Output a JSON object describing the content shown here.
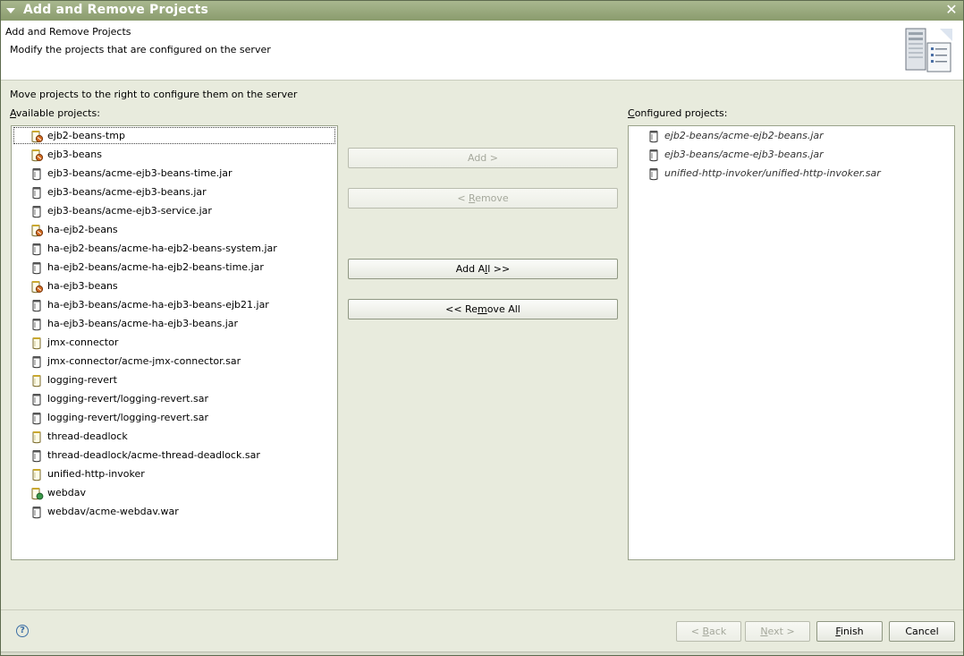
{
  "window": {
    "title": "Add and Remove Projects",
    "close_glyph": "✕"
  },
  "banner": {
    "title": "Add and Remove Projects",
    "description": "Modify the projects that are configured on the server",
    "icon": "server-icon"
  },
  "instruction": "Move projects to the right to configure them on the server",
  "available": {
    "label_mnemonic": "A",
    "label_rest": "vailable projects:",
    "items": [
      {
        "label": "ejb2-beans-tmp",
        "icon": "ejb-project-icon",
        "selected": true
      },
      {
        "label": "ejb3-beans",
        "icon": "ejb-project-icon"
      },
      {
        "label": "ejb3-beans/acme-ejb3-beans-time.jar",
        "icon": "jar-module-icon"
      },
      {
        "label": "ejb3-beans/acme-ejb3-beans.jar",
        "icon": "jar-module-icon"
      },
      {
        "label": "ejb3-beans/acme-ejb3-service.jar",
        "icon": "jar-module-icon"
      },
      {
        "label": "ha-ejb2-beans",
        "icon": "ejb-project-icon"
      },
      {
        "label": "ha-ejb2-beans/acme-ha-ejb2-beans-system.jar",
        "icon": "jar-module-icon"
      },
      {
        "label": "ha-ejb2-beans/acme-ha-ejb2-beans-time.jar",
        "icon": "jar-module-icon"
      },
      {
        "label": "ha-ejb3-beans",
        "icon": "ejb-project-icon"
      },
      {
        "label": "ha-ejb3-beans/acme-ha-ejb3-beans-ejb21.jar",
        "icon": "jar-module-icon"
      },
      {
        "label": "ha-ejb3-beans/acme-ha-ejb3-beans.jar",
        "icon": "jar-module-icon"
      },
      {
        "label": "jmx-connector",
        "icon": "sar-project-icon"
      },
      {
        "label": "jmx-connector/acme-jmx-connector.sar",
        "icon": "jar-module-icon"
      },
      {
        "label": "logging-revert",
        "icon": "sar-project-icon"
      },
      {
        "label": "logging-revert/logging-revert.sar",
        "icon": "jar-module-icon"
      },
      {
        "label": "logging-revert/logging-revert.sar",
        "icon": "jar-module-icon"
      },
      {
        "label": "thread-deadlock",
        "icon": "sar-project-icon"
      },
      {
        "label": "thread-deadlock/acme-thread-deadlock.sar",
        "icon": "jar-module-icon"
      },
      {
        "label": "unified-http-invoker",
        "icon": "sar-project-icon"
      },
      {
        "label": "webdav",
        "icon": "web-project-icon"
      },
      {
        "label": "webdav/acme-webdav.war",
        "icon": "jar-module-icon"
      }
    ]
  },
  "configured": {
    "label_mnemonic": "C",
    "label_rest": "onfigured projects:",
    "items": [
      {
        "label": "ejb2-beans/acme-ejb2-beans.jar",
        "icon": "jar-module-icon"
      },
      {
        "label": "ejb3-beans/acme-ejb3-beans.jar",
        "icon": "jar-module-icon"
      },
      {
        "label": "unified-http-invoker/unified-http-invoker.sar",
        "icon": "jar-module-icon"
      }
    ]
  },
  "buttons": {
    "add": {
      "pre": "Add >",
      "enabled": false
    },
    "remove": {
      "pre": "< ",
      "mn": "R",
      "post": "emove",
      "enabled": false
    },
    "add_all": {
      "pre": "Add A",
      "mn": "l",
      "post": "l >>",
      "enabled": true
    },
    "remove_all": {
      "pre": "<< Re",
      "mn": "m",
      "post": "ove All",
      "enabled": true
    }
  },
  "footer": {
    "help_glyph": "?",
    "back": {
      "pre": "< ",
      "mn": "B",
      "post": "ack",
      "enabled": false
    },
    "next": {
      "pre": "",
      "mn": "N",
      "post": "ext >",
      "enabled": false
    },
    "finish": {
      "pre": "",
      "mn": "F",
      "post": "inish",
      "enabled": true
    },
    "cancel": {
      "pre": "Cancel",
      "enabled": true
    }
  },
  "colors": {
    "accent": "#8a9b6d",
    "background": "#e8ebdd"
  }
}
